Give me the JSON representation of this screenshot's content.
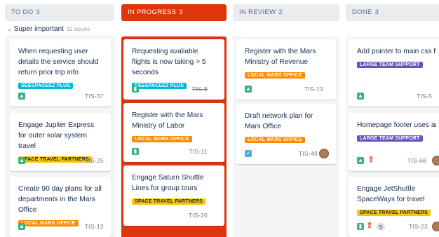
{
  "columns": [
    {
      "title": "TO DO",
      "count": "3"
    },
    {
      "title": "IN PROGRESS",
      "count": "3"
    },
    {
      "title": "IN REVIEW",
      "count": "2"
    },
    {
      "title": "DONE",
      "count": "3"
    }
  ],
  "swimlane": {
    "name": "Super important",
    "count": "11 issues"
  },
  "colors": {
    "accent": "#de350b",
    "column_bg": "#f4f5f7",
    "header_bg": "#ebecf0"
  },
  "cards": {
    "todo": [
      {
        "title": "When requesting user details the service should return prior trip info",
        "label": "SEESPACEEZ PLUS",
        "key": "TIS-37",
        "icon": "story-icon"
      },
      {
        "title": "Engage Jupiter Express for outer solar system travel",
        "label": "SPACE TRAVEL PARTNERS",
        "key": "TIS-25",
        "icon": "story-icon"
      },
      {
        "title": "Create 90 day plans for all departments in the Mars Office",
        "label": "LOCAL MARS OFFICE",
        "key": "TIS-12",
        "icon": "story-icon"
      }
    ],
    "progress": [
      {
        "title": "Requesting avaliable flights is now taking > 5 seconds",
        "label": "SEESPACEEZ PLUS",
        "key": "TIS-8",
        "icon": "story-icon"
      },
      {
        "title": "Register with the Mars Ministry of Labor",
        "label": "LOCAL MARS OFFICE",
        "key": "TIS-11",
        "icon": "story-icon"
      },
      {
        "title": "Engage Saturn Shuttle Lines for group tours",
        "label": "SPACE TRAVEL PARTNERS",
        "key": "TIS-20"
      }
    ],
    "review": [
      {
        "title": "Register with the Mars Ministry of Revenue",
        "label": "LOCAL MARS OFFICE",
        "key": "TIS-13",
        "icon": "story-icon"
      },
      {
        "title": "Draft network plan for Mars Office",
        "label": "LOCAL MARS OFFICE",
        "key": "TIS-49",
        "icon": "task-icon"
      }
    ],
    "done": [
      {
        "title": "Add pointer to main css file to instruct users to create child themes",
        "label": "LARGE TEAM SUPPORT",
        "key": "TIS-5",
        "icon": "story-icon"
      },
      {
        "title": "Homepage footer uses an inline style - should use a class",
        "label": "LARGE TEAM SUPPORT",
        "key": "TIS-68",
        "icon": "story-icon"
      },
      {
        "title": "Engage JetShuttle SpaceWays for travel",
        "label": "SPACE TRAVEL PARTNERS",
        "key": "TIS-23",
        "points": "5",
        "icon": "story-icon"
      }
    ]
  }
}
